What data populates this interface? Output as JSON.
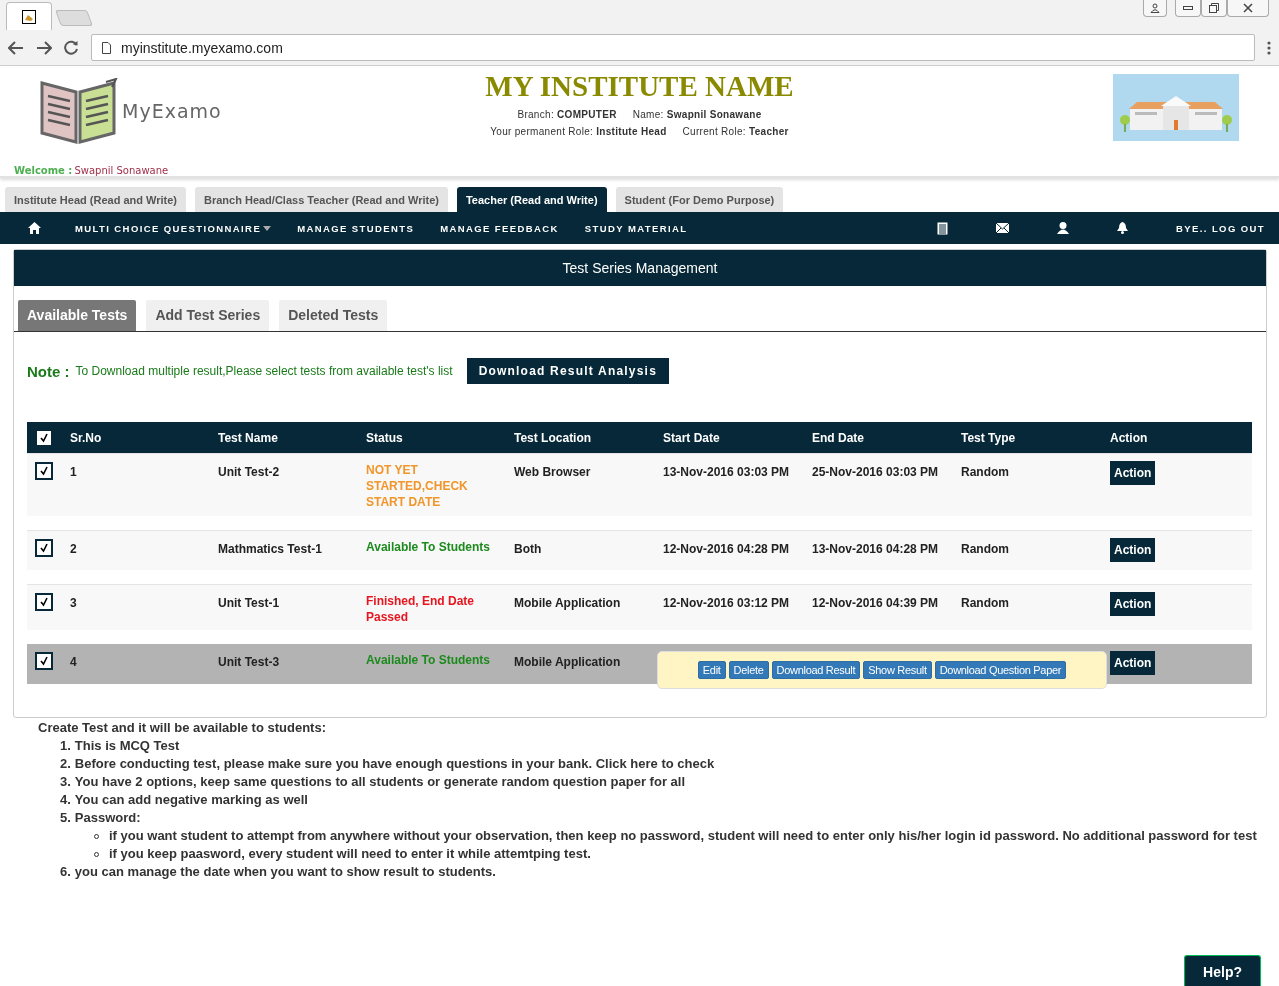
{
  "browser": {
    "url": "myinstitute.myexamo.com"
  },
  "header": {
    "logo_text": "MyExamo",
    "title": "MY INSTITUTE NAME",
    "info_rows": [
      [
        {
          "label": "Branch: ",
          "value": "COMPUTER"
        },
        {
          "label": "Name: ",
          "value": "Swapnil Sonawane"
        }
      ],
      [
        {
          "label": "Your permanent Role: ",
          "value": "Institute Head"
        },
        {
          "label": "Current Role: ",
          "value": "Teacher"
        }
      ]
    ],
    "welcome_label": "Welcome :",
    "welcome_name": "Swapnil Sonawane"
  },
  "role_tabs": [
    {
      "label": "Institute Head (Read and Write)",
      "selected": false
    },
    {
      "label": "Branch Head/Class Teacher (Read and Write)",
      "selected": false
    },
    {
      "label": "Teacher (Read and Write)",
      "selected": true
    },
    {
      "label": "Student (For Demo Purpose)",
      "selected": false
    }
  ],
  "nav": {
    "items": [
      {
        "label": "MULTI CHOICE QUESTIONNAIRE",
        "dropdown": true
      },
      {
        "label": "MANAGE STUDENTS",
        "dropdown": false
      },
      {
        "label": "MANAGE FEEDBACK",
        "dropdown": false
      },
      {
        "label": "STUDY MATERIAL",
        "dropdown": false
      }
    ],
    "logout": "BYE.. LOG OUT"
  },
  "panel": {
    "title": "Test Series Management",
    "tabs": [
      {
        "label": "Available Tests",
        "selected": true
      },
      {
        "label": "Add Test Series",
        "selected": false
      },
      {
        "label": "Deleted Tests",
        "selected": false
      }
    ],
    "note_label": "Note :",
    "note_text": "To Download multiple result,Please select tests from available test's list",
    "download_button": "Download Result Analysis",
    "table": {
      "all_checked": true,
      "columns": [
        "Sr.No",
        "Test Name",
        "Status",
        "Test Location",
        "Start Date",
        "End Date",
        "Test Type",
        "Action"
      ],
      "rows": [
        {
          "checked": true,
          "selected": false,
          "sr": "1",
          "name": "Unit Test-2",
          "status": "NOT YET STARTED,CHECK START DATE",
          "color": "#f0962a",
          "location": "Web Browser",
          "start": "13-Nov-2016 03:03 PM",
          "end": "25-Nov-2016 03:03 PM",
          "type": "Random",
          "action": "Action"
        },
        {
          "checked": true,
          "selected": false,
          "sr": "2",
          "name": "Mathmatics Test-1",
          "status": "Available To Students",
          "color": "#1d8a1d",
          "location": "Both",
          "start": "12-Nov-2016 04:28 PM",
          "end": "13-Nov-2016 04:28 PM",
          "type": "Random",
          "action": "Action"
        },
        {
          "checked": true,
          "selected": false,
          "sr": "3",
          "name": "Unit Test-1",
          "status": "Finished, End Date Passed",
          "color": "#e8141e",
          "location": "Mobile Application",
          "start": "12-Nov-2016 03:12 PM",
          "end": "12-Nov-2016 04:39 PM",
          "type": "Random",
          "action": "Action"
        },
        {
          "checked": true,
          "selected": true,
          "sr": "4",
          "name": "Unit Test-3",
          "status": "Available To Students",
          "color": "#1d8a1d",
          "location": "Mobile Application",
          "action": "Action",
          "menu": [
            "Edit",
            "Delete",
            "Download Result",
            "Show Result",
            "Download Question Paper"
          ]
        }
      ]
    }
  },
  "instructions": {
    "intro": "Create Test and it will be available to students:",
    "items": [
      {
        "number": "1.",
        "text": "This is MCQ Test"
      },
      {
        "number": "2.",
        "text": "Before conducting test, please make sure you have enough questions in your bank. Click here to check"
      },
      {
        "number": "3.",
        "text": "You have 2 options, keep same questions to all students or generate random question paper for all"
      },
      {
        "number": "4.",
        "text": "You can add negative marking as well"
      },
      {
        "number": "5.",
        "text": "Password:",
        "children": [
          "if you want student to attempt from anywhere without your observation, then keep no password, student will need to enter only his/her login id password. No additional password for test",
          "if you keep paasword, every student will need to enter it while attemtping test."
        ]
      },
      {
        "number": "6.",
        "text": "you can manage the date when you want to show result to students."
      }
    ]
  },
  "help": "Help?"
}
